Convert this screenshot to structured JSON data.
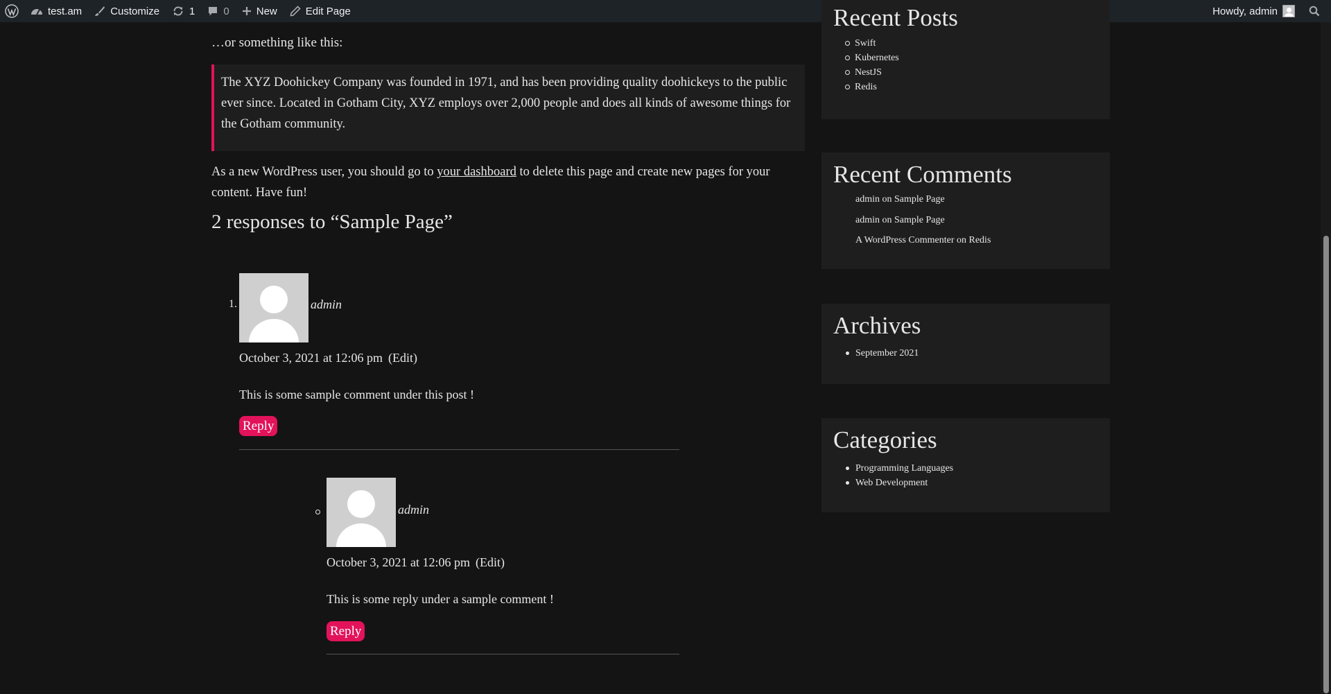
{
  "adminbar": {
    "site_name": "test.am",
    "customize": "Customize",
    "updates_count": "1",
    "comments_count": "0",
    "new": "New",
    "edit_page": "Edit Page",
    "howdy": "Howdy, admin"
  },
  "content": {
    "intro": "…or something like this:",
    "quote": "The XYZ Doohickey Company was founded in 1971, and has been providing quality doohickeys to the public ever since. Located in Gotham City, XYZ employs over 2,000 people and does all kinds of awesome things for the Gotham community.",
    "dash_before": "As a new WordPress user, you should go to ",
    "dash_link": "your dashboard",
    "dash_after": " to delete this page and create new pages for your content. Have fun!",
    "comments_title": "2 responses to “Sample Page”"
  },
  "comments": [
    {
      "marker": "1.",
      "author": "admin",
      "date": "October 3, 2021 at 12:06 pm",
      "edit": "(Edit)",
      "text": "This is some sample comment under this post !",
      "reply": "Reply"
    },
    {
      "author": "admin",
      "date": "October 3, 2021 at 12:06 pm",
      "edit": "(Edit)",
      "text": "This is some reply under a sample comment !",
      "reply": "Reply"
    }
  ],
  "sidebar": {
    "recent_posts_title": "Recent Posts",
    "recent_posts": [
      "Swift",
      "Kubernetes",
      "NestJS",
      "Redis"
    ],
    "recent_comments_title": "Recent Comments",
    "recent_comments": [
      {
        "author": "admin",
        "on": "on",
        "post": "Sample Page"
      },
      {
        "author": "admin",
        "on": "on",
        "post": "Sample Page"
      },
      {
        "author": "A WordPress Commenter",
        "on": "on",
        "post": "Redis"
      }
    ],
    "archives_title": "Archives",
    "archives": [
      "September 2021"
    ],
    "categories_title": "Categories",
    "categories": [
      "Programming Languages",
      "Web Development"
    ]
  },
  "icons": {
    "wp": "wordpress-logo-icon",
    "dashboard": "dashboard-icon",
    "brush": "brush-icon",
    "updates": "updates-icon",
    "comment": "comment-bubble-icon",
    "plus": "plus-icon",
    "pencil": "pencil-icon",
    "search": "search-icon"
  },
  "colors": {
    "accent": "#e2135a",
    "background": "#141414",
    "adminbar": "#1d2327",
    "widget": "#1e1e1e"
  }
}
